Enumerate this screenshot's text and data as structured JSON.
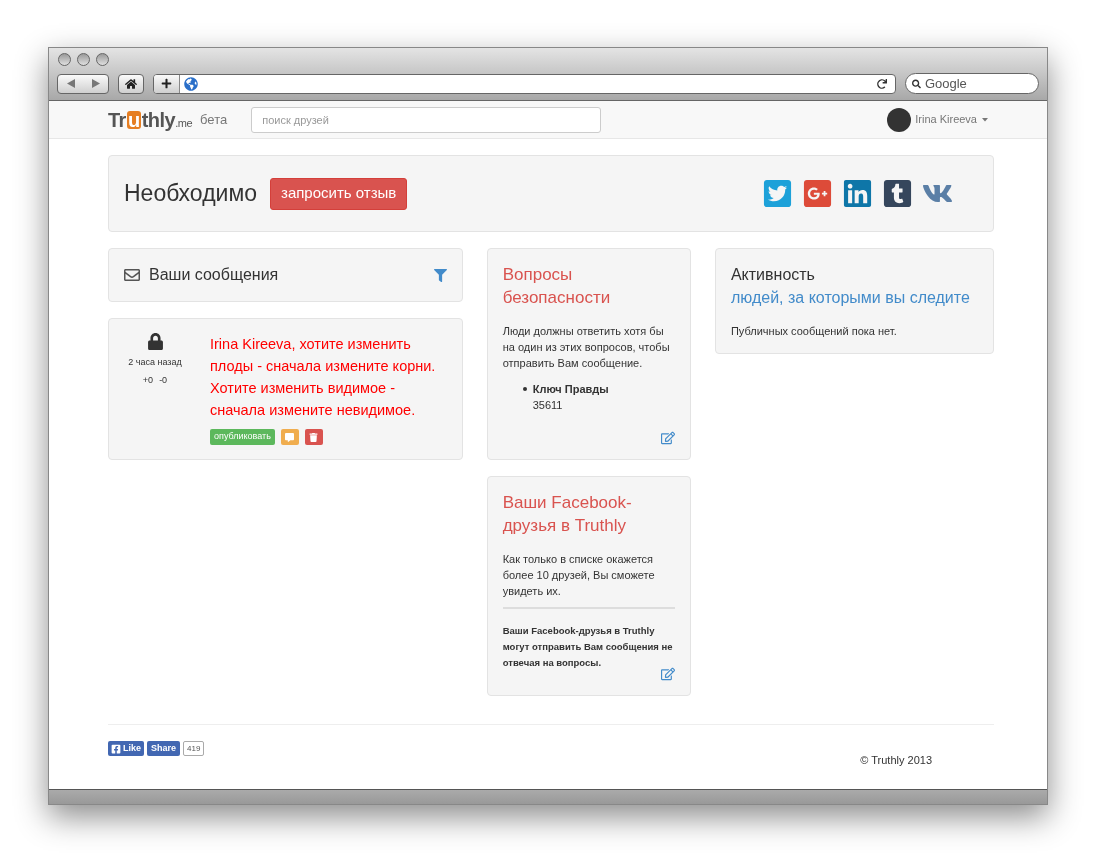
{
  "browser": {
    "search_placeholder": "Google"
  },
  "navbar": {
    "logo": {
      "prefix": "Tr",
      "highlight": "u",
      "suffix": "thly",
      "domain": ".me"
    },
    "badge": "бета",
    "search": {
      "placeholder": "поиск друзей"
    },
    "user": {
      "name": "Irina Kireeva"
    }
  },
  "hero": {
    "title": "Необходимо",
    "button": "запросить отзыв",
    "social": [
      {
        "kind": "twitter"
      },
      {
        "kind": "googleplus"
      },
      {
        "kind": "linkedin"
      },
      {
        "kind": "tumblr"
      },
      {
        "kind": "vk"
      }
    ]
  },
  "messages_panel": {
    "title": "Ваши сообщения"
  },
  "messages": [
    {
      "locked": true,
      "time": "2 часа назад",
      "plus": "+0",
      "minus": "-0",
      "text": "Irina Kireeva, хотите изменить плоды - сначала измените корни. Хотите изменить видимое - сначала измените невидимое.",
      "publish_button": "опубликовать"
    }
  ],
  "questions_card": {
    "title": "Вопросы безопасности",
    "text": "Люди должны ответить хотя бы на один из этих вопросов, чтобы отправить Вам сообщение.",
    "items": [
      {
        "question": "Ключ Правды",
        "answer": "35611"
      }
    ]
  },
  "friends_card": {
    "title": "Ваши Facebook-друзья в Truthly",
    "text": "Как только в списке окажется более 10 друзей, Вы сможете увидеть их.",
    "note": "Ваши Facebook-друзья в Truthly могут отправить Вам сообщения не отвечая на вопросы."
  },
  "activity_card": {
    "title": "Активность",
    "link": "людей, за которыми вы следите",
    "text": "Публичных сообщений пока нет."
  },
  "footer": {
    "like": "Like",
    "share": "Share",
    "count": "419",
    "copyright": "© Truthly 2013"
  }
}
